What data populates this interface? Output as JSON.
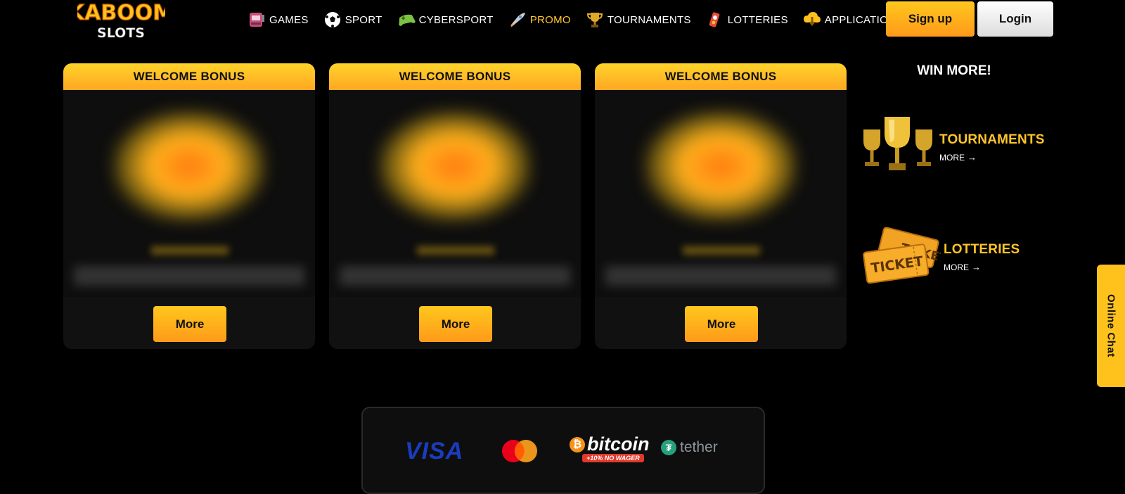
{
  "header": {
    "logo_line1": "KABOOM",
    "logo_line2": "SLOTS",
    "nav": [
      {
        "label": "GAMES",
        "icon": "slot-machine-icon"
      },
      {
        "label": "SPORT",
        "icon": "soccer-ball-icon"
      },
      {
        "label": "CYBERSPORT",
        "icon": "gamepad-icon"
      },
      {
        "label": "PROMO",
        "icon": "rocket-icon",
        "active": true
      },
      {
        "label": "TOURNAMENTS",
        "icon": "trophy-icon"
      },
      {
        "label": "LOTTERIES",
        "icon": "lottery-icon"
      },
      {
        "label": "APPLICATION",
        "icon": "download-cloud-icon"
      }
    ],
    "signup_label": "Sign up",
    "login_label": "Login"
  },
  "promos": [
    {
      "title": "WELCOME BONUS",
      "button": "More"
    },
    {
      "title": "WELCOME BONUS",
      "button": "More"
    },
    {
      "title": "WELCOME BONUS",
      "button": "More"
    }
  ],
  "sidebar": {
    "title": "WIN MORE!",
    "links": [
      {
        "title": "TOURNAMENTS",
        "more": "MORE",
        "icon": "trophies-icon"
      },
      {
        "title": "LOTTERIES",
        "more": "MORE",
        "icon": "tickets-icon"
      }
    ]
  },
  "chat": {
    "label": "Online Chat"
  },
  "payments": {
    "visa": "VISA",
    "mastercard": "mastercard-logo",
    "bitcoin": "bitcoin",
    "bitcoin_badge": "+10% NO WAGER",
    "tether": "tether"
  },
  "colors": {
    "accent": "#ffc52a",
    "button_gradient_top": "#ffc71d",
    "button_gradient_bottom": "#ff9a1a",
    "background": "#000000",
    "card": "#111111"
  }
}
